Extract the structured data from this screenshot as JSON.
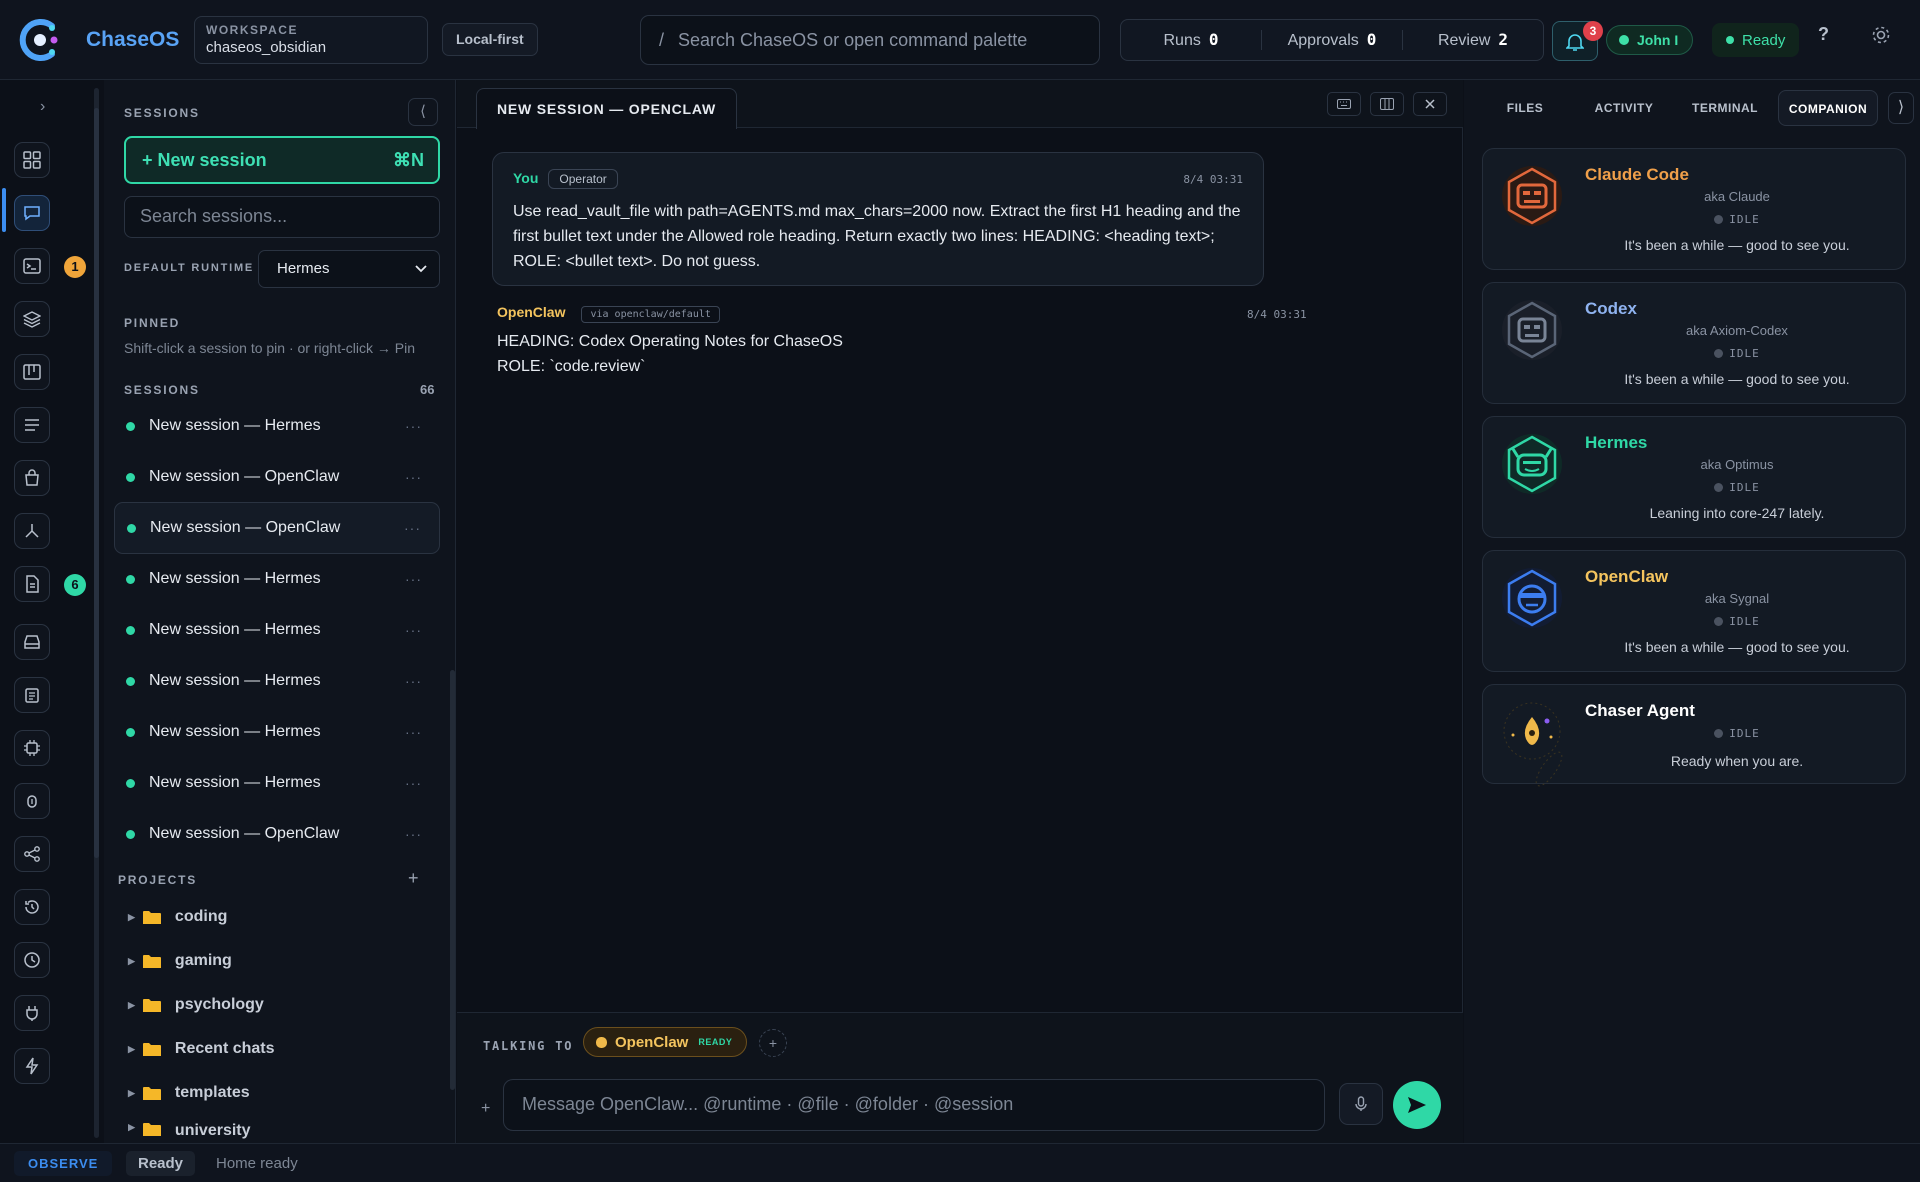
{
  "app": {
    "name": "ChaseOS"
  },
  "workspace": {
    "key": "WORKSPACE",
    "value": "chaseos_obsidian"
  },
  "mode_badge": "Local-first",
  "search": {
    "slash": "/",
    "placeholder": "Search ChaseOS or open command palette"
  },
  "stats": {
    "runs_label": "Runs",
    "runs": "0",
    "approvals_label": "Approvals",
    "approvals": "0",
    "review_label": "Review",
    "review": "2"
  },
  "notifications": {
    "count": "3"
  },
  "user": {
    "name": "John I"
  },
  "status_ready": "Ready",
  "help": "?",
  "rail": {
    "items": [
      "dashboard-icon",
      "chat-icon",
      "terminal-icon",
      "layers-icon",
      "kanban-icon",
      "list-icon",
      "shopping-bag-icon",
      "graph-icon",
      "document-icon",
      "inbox-icon",
      "notes-icon",
      "cpu-icon",
      "bug-icon",
      "share-icon",
      "history-icon",
      "clock-icon",
      "plug-icon",
      "bolt-icon"
    ],
    "badge_terminal": "1",
    "badge_document": "6"
  },
  "sidebar": {
    "heading": "SESSIONS",
    "collapse": "⟨",
    "new_session_label": "+ New session",
    "new_session_shortcut": "⌘N",
    "search_placeholder": "Search sessions...",
    "default_runtime_label": "DEFAULT RUNTIME",
    "default_runtime_value": "Hermes",
    "pinned_label": "PINNED",
    "pinned_hint": "Shift-click a session to pin · or right-click → Pin",
    "sessions_label": "SESSIONS",
    "sessions_count": "66",
    "sessions": [
      "New session — Hermes",
      "New session — OpenClaw",
      "New session — OpenClaw",
      "New session — Hermes",
      "New session — Hermes",
      "New session — Hermes",
      "New session — Hermes",
      "New session — Hermes",
      "New session — OpenClaw"
    ],
    "more": "···",
    "projects_label": "PROJECTS",
    "projects_add": "+",
    "projects": [
      "coding",
      "gaming",
      "psychology",
      "Recent chats",
      "templates",
      "university"
    ]
  },
  "main": {
    "tab_title": "NEW SESSION — OPENCLAW",
    "user_message": {
      "author": "You",
      "role": "Operator",
      "time": "8/4 03:31",
      "text": "Use read_vault_file with path=AGENTS.md max_chars=2000 now. Extract the first H1 heading and the first bullet text under the Allowed role heading. Return exactly two lines: HEADING: <heading text>; ROLE: <bullet text>. Do not guess."
    },
    "agent_message": {
      "author": "OpenClaw",
      "via": "via openclaw/default",
      "time": "8/4 03:31",
      "line1": "HEADING: Codex Operating Notes for ChaseOS",
      "line2": "ROLE: `code.review`"
    },
    "talking_to_label": "TALKING TO",
    "talking_to_name": "OpenClaw",
    "talking_to_status": "READY",
    "add_agent": "+",
    "composer_plus": "+",
    "composer_placeholder": "Message OpenClaw...   @runtime · @file · @folder · @session"
  },
  "right": {
    "tabs": [
      "FILES",
      "ACTIVITY",
      "TERMINAL",
      "COMPANION"
    ],
    "expand": "⟩",
    "companions": [
      {
        "name": "Claude Code",
        "aka": "aka Claude",
        "status": "IDLE",
        "message": "It's been a while — good to see you.",
        "color": "#f0a04a"
      },
      {
        "name": "Codex",
        "aka": "aka Axiom-Codex",
        "status": "IDLE",
        "message": "It's been a while — good to see you.",
        "color": "#8fb3f0"
      },
      {
        "name": "Hermes",
        "aka": "aka Optimus",
        "status": "IDLE",
        "message": "Leaning into core-247 lately.",
        "color": "#2fd8a6"
      },
      {
        "name": "OpenClaw",
        "aka": "aka Sygnal",
        "status": "IDLE",
        "message": "It's been a while — good to see you.",
        "color": "#f4c45e"
      },
      {
        "name": "Chaser Agent",
        "aka": "",
        "status": "IDLE",
        "message": "Ready when you are.",
        "color": "#ffffff"
      }
    ]
  },
  "statusbar": {
    "mode": "OBSERVE",
    "state": "Ready",
    "message": "Home ready"
  },
  "colors": {
    "accent": "#2fd8a6",
    "brand": "#59a3f5",
    "danger": "#e0414b",
    "warning": "#f0b94a"
  }
}
